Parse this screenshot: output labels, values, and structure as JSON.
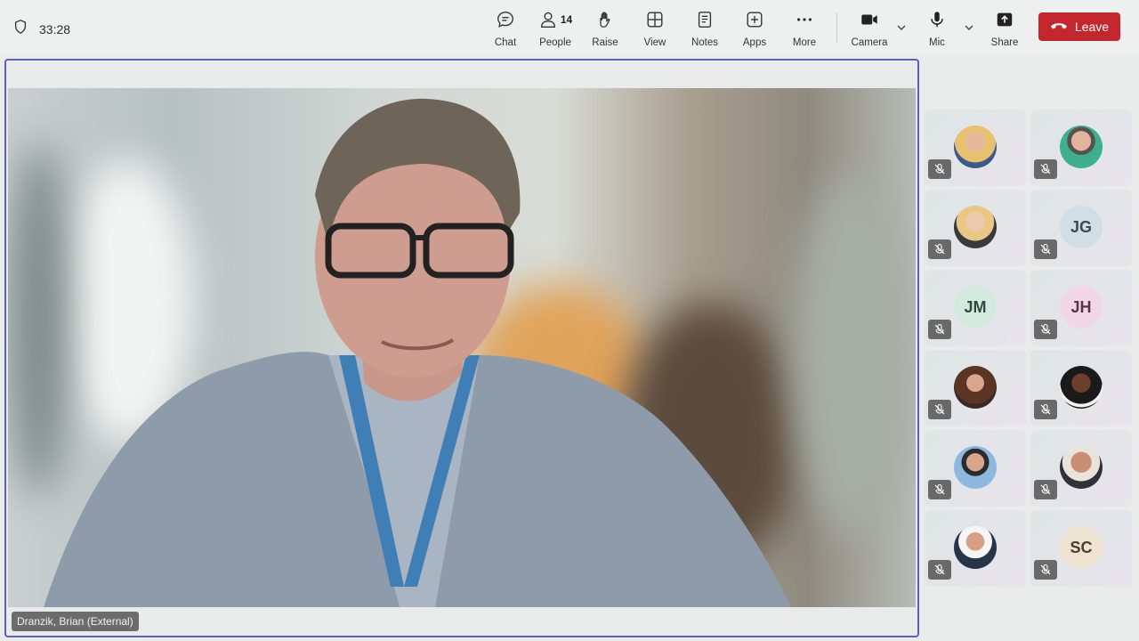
{
  "meeting": {
    "timer": "33:28"
  },
  "toolbar": {
    "chat": "Chat",
    "people": "People",
    "people_count": "14",
    "raise": "Raise",
    "view": "View",
    "notes": "Notes",
    "apps": "Apps",
    "more": "More",
    "camera": "Camera",
    "mic": "Mic",
    "share": "Share",
    "leave": "Leave"
  },
  "colors": {
    "leave": "#c4262e",
    "active_border": "#5b5fc7"
  },
  "stage": {
    "speaker_name": "Dranzik, Brian (External)"
  },
  "participants": [
    {
      "initials": "",
      "type": "photo",
      "muted": true
    },
    {
      "initials": "",
      "type": "photo",
      "muted": true
    },
    {
      "initials": "",
      "type": "photo",
      "muted": true
    },
    {
      "initials": "JG",
      "type": "initials",
      "muted": true
    },
    {
      "initials": "JM",
      "type": "initials",
      "muted": true
    },
    {
      "initials": "JH",
      "type": "initials",
      "muted": true
    },
    {
      "initials": "",
      "type": "photo",
      "muted": true
    },
    {
      "initials": "",
      "type": "photo",
      "muted": true
    },
    {
      "initials": "",
      "type": "photo",
      "muted": true
    },
    {
      "initials": "",
      "type": "photo",
      "muted": true
    },
    {
      "initials": "",
      "type": "photo",
      "muted": true
    },
    {
      "initials": "SC",
      "type": "initials",
      "muted": true
    }
  ],
  "icons": [
    "shield-icon",
    "chat-icon",
    "people-icon",
    "raise-hand-icon",
    "view-icon",
    "notes-icon",
    "apps-icon",
    "more-icon",
    "camera-icon",
    "mic-icon",
    "share-icon",
    "phone-icon",
    "mic-muted-icon"
  ]
}
